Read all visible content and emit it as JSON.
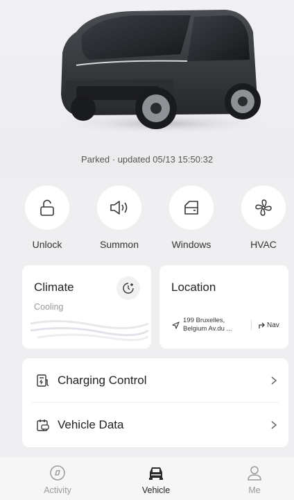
{
  "vehicle": {
    "status": "Parked · updated 05/13 15:50:32"
  },
  "actions": [
    {
      "label": "Unlock",
      "icon": "unlock-icon"
    },
    {
      "label": "Summon",
      "icon": "speaker-icon"
    },
    {
      "label": "Windows",
      "icon": "window-icon"
    },
    {
      "label": "HVAC",
      "icon": "fan-icon"
    }
  ],
  "climate": {
    "title": "Climate",
    "mode": "Cooling"
  },
  "location": {
    "title": "Location",
    "address": "199 Bruxelles, Belgium Av.du ...",
    "nav_label": "Nav"
  },
  "menu": {
    "charging_label": "Charging Control",
    "vehicle_data_label": "Vehicle Data"
  },
  "tabs": [
    {
      "label": "Activity",
      "icon": "compass-icon",
      "active": false
    },
    {
      "label": "Vehicle",
      "icon": "car-icon",
      "active": true
    },
    {
      "label": "Me",
      "icon": "person-icon",
      "active": false
    }
  ],
  "colors": {
    "background": "#efeff1",
    "card": "#ffffff",
    "active_tab": "#222222",
    "inactive_tab": "#999999"
  }
}
